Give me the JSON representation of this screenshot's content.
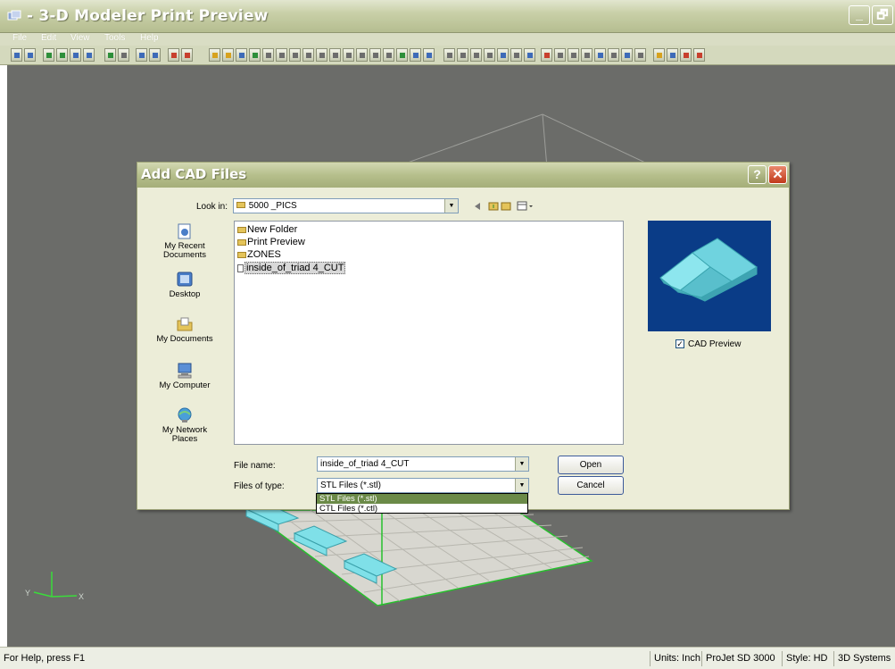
{
  "window": {
    "title": "- 3-D Modeler Print Preview",
    "minimize_glyph": "_",
    "restore_glyph": "🗗"
  },
  "menu": [
    "File",
    "Edit",
    "View",
    "Tools",
    "Help"
  ],
  "status_bar": {
    "help_text": "For Help, press F1",
    "units": "Units: Inch",
    "printer": "ProJet SD 3000",
    "style": "Style: HD",
    "vendor": "3D Systems"
  },
  "axes": {
    "y_label": "Y",
    "x_label": "X"
  },
  "dialog": {
    "title": "Add CAD Files",
    "help_glyph": "?",
    "close_glyph": "✕",
    "look_in_label": "Look in:",
    "look_in_value": "5000 _PICS",
    "places": [
      {
        "label": "My Recent Documents",
        "icon": "recent-documents-icon"
      },
      {
        "label": "Desktop",
        "icon": "desktop-icon"
      },
      {
        "label": "My Documents",
        "icon": "my-documents-icon"
      },
      {
        "label": "My Computer",
        "icon": "my-computer-icon"
      },
      {
        "label": "My Network Places",
        "icon": "network-places-icon"
      }
    ],
    "files": [
      {
        "name": "New Folder",
        "kind": "folder"
      },
      {
        "name": "Print Preview",
        "kind": "folder"
      },
      {
        "name": "ZONES",
        "kind": "folder"
      },
      {
        "name": "inside_of_triad 4_CUT",
        "kind": "file",
        "selected": true
      }
    ],
    "file_name_label": "File name:",
    "file_name_value": "inside_of_triad 4_CUT",
    "files_of_type_label": "Files of type:",
    "files_of_type_value": "STL Files  (*.stl)",
    "type_options": [
      "STL Files  (*.stl)",
      "CTL Files  (*.ctl)"
    ],
    "open_label": "Open",
    "cancel_label": "Cancel",
    "cad_preview_label": "CAD Preview",
    "cad_preview_checked": true
  },
  "colors": {
    "workspace": "#6b6c69",
    "dialog_bg": "#ecedd8",
    "preview_bg": "#0a3c87",
    "model_fill": "#7fe0e8",
    "build_grid": "#d8d7d0",
    "platform_edge": "#27c02d"
  }
}
